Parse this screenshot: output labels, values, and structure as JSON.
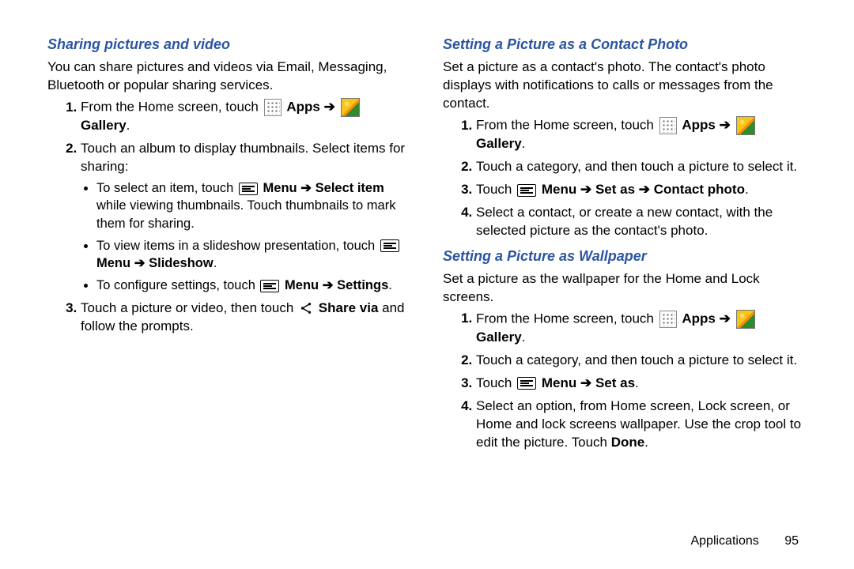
{
  "arrow": "➔",
  "left": {
    "h_sharing": "Sharing pictures and video",
    "sharing_intro": "You can share pictures and videos via Email, Messaging, Bluetooth or popular sharing services.",
    "step1_a": "From the Home screen, touch ",
    "apps": "Apps",
    "gallery": "Gallery",
    "step2": "Touch an album to display thumbnails. Select items for sharing:",
    "b1_a": "To select an item, touch ",
    "b1_menu": "Menu",
    "b1_b": "Select item",
    "b1_c": " while viewing thumbnails. Touch thumbnails to mark them for sharing.",
    "b2_a": "To view items in a slideshow presentation, touch ",
    "b2_menu": "Menu",
    "b2_b": "Slideshow",
    "b3_a": "To configure settings, touch ",
    "b3_menu": "Menu",
    "b3_b": "Settings",
    "step3_a": "Touch a picture or video, then touch ",
    "step3_b": "Share via",
    "step3_c": " and follow the prompts."
  },
  "right": {
    "h_contact": "Setting a Picture as a Contact Photo",
    "contact_intro": "Set a picture as a contact's photo. The contact's photo displays with notifications to calls or messages from the contact.",
    "c_step1_a": "From the Home screen, touch ",
    "apps": "Apps",
    "gallery": "Gallery",
    "c_step2": "Touch a category, and then touch a picture to select it.",
    "c_step3_a": "Touch ",
    "c_step3_menu": "Menu",
    "c_step3_b": "Set as",
    "c_step3_c": "Contact photo",
    "c_step4": "Select a contact, or create a new contact, with the selected picture as the contact's photo.",
    "h_wall": "Setting a Picture as Wallpaper",
    "wall_intro": "Set a picture as the wallpaper for the Home and Lock screens.",
    "w_step1_a": "From the Home screen, touch ",
    "w_step2": "Touch a category, and then touch a picture to select it.",
    "w_step3_a": "Touch ",
    "w_step3_menu": "Menu",
    "w_step3_b": "Set as",
    "w_step4_a": "Select an option, from Home screen, Lock screen, or Home and lock screens wallpaper. Use the crop tool to edit the picture. Touch ",
    "w_step4_b": "Done",
    "w_step4_c": "."
  },
  "footer": {
    "section": "Applications",
    "page": "95"
  }
}
